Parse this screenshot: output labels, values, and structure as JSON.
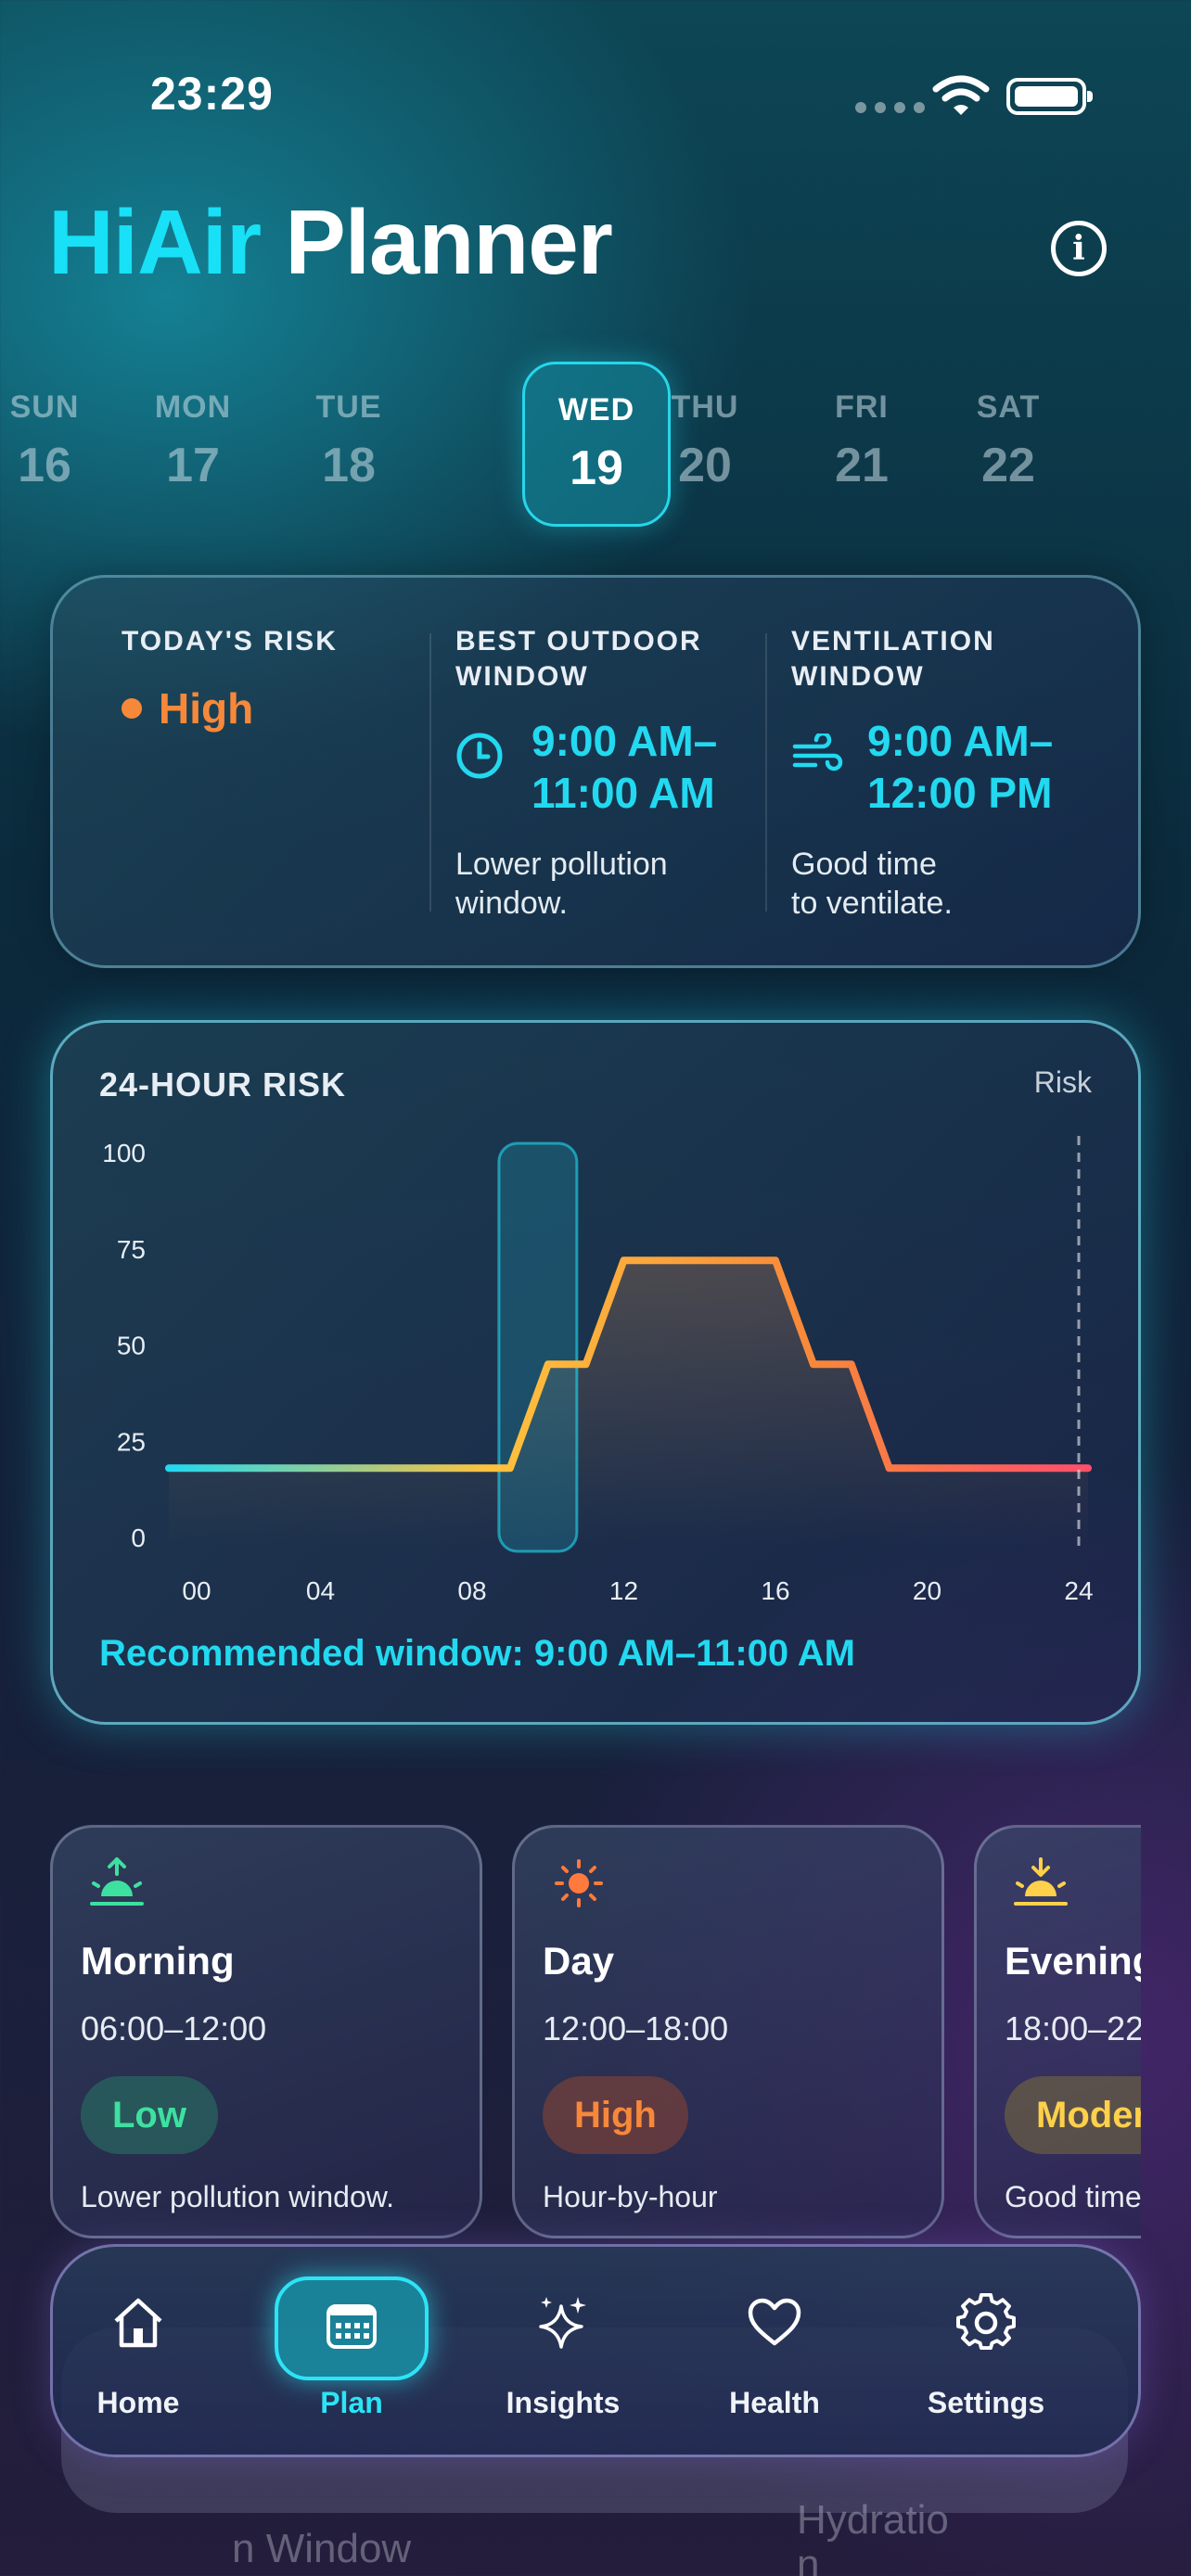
{
  "status_bar": {
    "time": "23:29"
  },
  "header": {
    "brand": "HiAir",
    "title": "Planner"
  },
  "days": [
    {
      "name": "SUN",
      "date": "16",
      "selected": false
    },
    {
      "name": "MON",
      "date": "17",
      "selected": false
    },
    {
      "name": "TUE",
      "date": "18",
      "selected": false
    },
    {
      "name": "WED",
      "date": "19",
      "selected": true
    },
    {
      "name": "THU",
      "date": "20",
      "selected": false
    },
    {
      "name": "FRI",
      "date": "21",
      "selected": false
    },
    {
      "name": "SAT",
      "date": "22",
      "selected": false
    }
  ],
  "summary": {
    "risk_label": "TODAY'S RISK",
    "risk_level": "High",
    "outdoor_label_1": "BEST OUTDOOR",
    "outdoor_label_2": "WINDOW",
    "outdoor_time_1": "9:00 AM–",
    "outdoor_time_2": "11:00 AM",
    "outdoor_note_1": "Lower pollution",
    "outdoor_note_2": "window.",
    "vent_label_1": "VENTILATION",
    "vent_label_2": "WINDOW",
    "vent_time_1": "9:00 AM–",
    "vent_time_2": "12:00 PM",
    "vent_note_1": "Good time",
    "vent_note_2": "to ventilate."
  },
  "chart": {
    "title": "24-HOUR RISK",
    "legend": "Risk",
    "recommendation": "Recommended window: 9:00 AM–11:00 AM"
  },
  "chart_data": {
    "type": "line",
    "title": "24-HOUR RISK",
    "x": [
      0,
      9,
      10,
      11,
      12,
      13,
      14,
      15,
      16,
      17,
      18,
      19,
      24
    ],
    "series": [
      {
        "name": "Risk",
        "values": [
          18,
          18,
          45,
          45,
          72,
          72,
          72,
          72,
          72,
          45,
          45,
          18,
          18
        ]
      }
    ],
    "x_ticks": [
      "00",
      "04",
      "08",
      "12",
      "16",
      "20",
      "24"
    ],
    "y_ticks": [
      "0",
      "25",
      "50",
      "75",
      "100"
    ],
    "xlim": [
      0,
      24
    ],
    "ylim": [
      0,
      100
    ],
    "highlight_window": [
      9,
      11
    ],
    "grid": false,
    "colors": {
      "low": "#22d9f0",
      "mid": "#ffc23d",
      "high": "#f7883a",
      "end": "#ff4f6b"
    }
  },
  "periods": [
    {
      "name": "Morning",
      "time": "06:00–12:00",
      "badge": "Low",
      "badge_color": "#3ee0a0",
      "badge_bg": "rgba(40,120,100,0.55)",
      "note": "Lower pollution window.",
      "icon": "sunrise-icon"
    },
    {
      "name": "Day",
      "time": "12:00–18:00",
      "badge": "High",
      "badge_color": "#f7883a",
      "badge_bg": "rgba(140,70,50,0.55)",
      "note": "Hour-by-hour",
      "icon": "sun-icon"
    },
    {
      "name": "Evening",
      "time": "18:00–22",
      "badge": "Moder",
      "badge_color": "#ffd04a",
      "badge_bg": "rgba(120,110,60,0.55)",
      "note": "Good time",
      "icon": "sunset-icon"
    }
  ],
  "ghost": {
    "left": "n Window",
    "right_1": "Hydratio",
    "right_2": "n"
  },
  "nav": [
    {
      "label": "Home",
      "icon": "home-icon"
    },
    {
      "label": "Plan",
      "icon": "calendar-icon"
    },
    {
      "label": "Insights",
      "icon": "sparkles-icon"
    },
    {
      "label": "Health",
      "icon": "heart-icon"
    },
    {
      "label": "Settings",
      "icon": "gear-icon"
    }
  ]
}
